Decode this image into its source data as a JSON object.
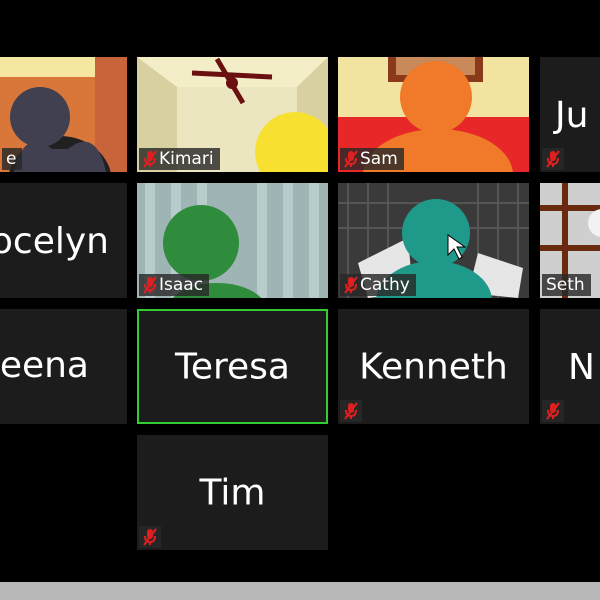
{
  "participants": {
    "tile_1": {
      "name": "e",
      "muted": false
    },
    "tile_2": {
      "name": "Kimari",
      "muted": true
    },
    "tile_3": {
      "name": "Sam",
      "muted": true
    },
    "tile_4": {
      "name": "Ju",
      "muted": true
    },
    "tile_5": {
      "name": "ocelyn"
    },
    "tile_6": {
      "name": "Isaac",
      "muted": true
    },
    "tile_7": {
      "name": "Cathy",
      "muted": true
    },
    "tile_8": {
      "name": "Seth"
    },
    "tile_9": {
      "name": "eena"
    },
    "tile_10": {
      "name": "Teresa",
      "active_speaker": true
    },
    "tile_11": {
      "name": "Kenneth",
      "muted": true
    },
    "tile_12": {
      "name": "N",
      "muted": true
    },
    "tile_13": {
      "name": "Tim",
      "muted": true
    }
  },
  "icons": {
    "muted_mic": "muted-mic-icon"
  },
  "colors": {
    "tile_background": "#1c1c1c",
    "active_speaker_border": "#33cc33",
    "mute_icon": "#e02020",
    "bottom_bar": "#b8b8b8"
  }
}
